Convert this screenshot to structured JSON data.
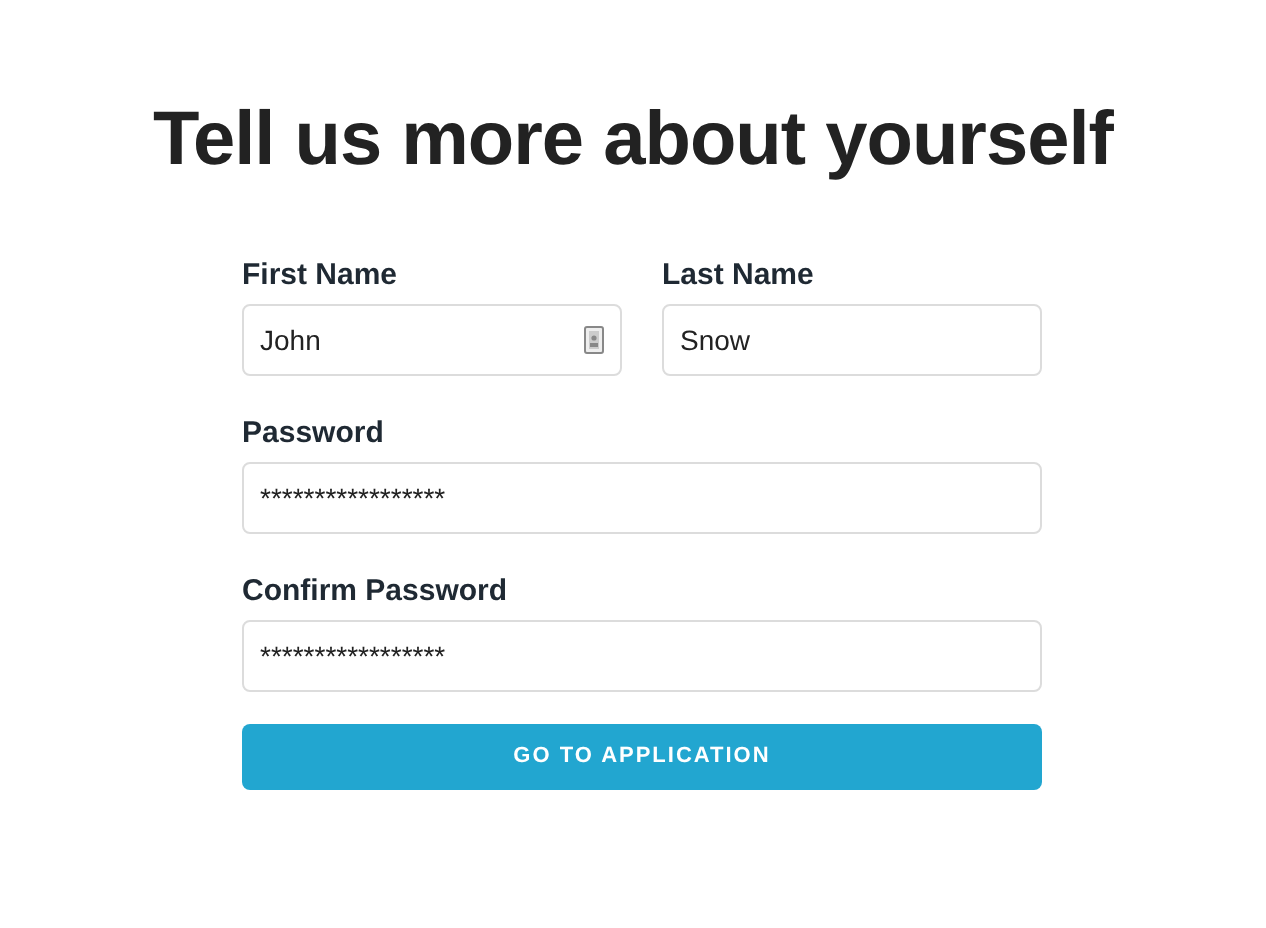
{
  "title": "Tell us more about yourself",
  "fields": [
    {
      "label": "First Name",
      "value": "John",
      "icon": true
    },
    {
      "label": "Last Name",
      "value": "Snow",
      "icon": false
    },
    {
      "label": "Password",
      "value": "*****************",
      "icon": false
    },
    {
      "label": "Confirm Password",
      "value": "*****************",
      "icon": false
    }
  ],
  "button": "GO TO APPLICATION"
}
